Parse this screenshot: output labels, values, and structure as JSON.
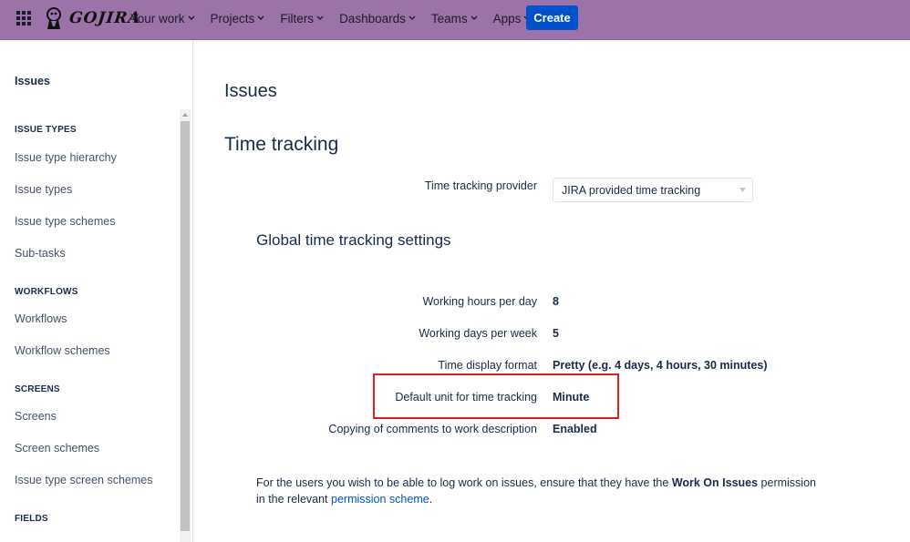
{
  "header": {
    "logo_text": "GOJIRA",
    "nav": [
      {
        "label": "Your work"
      },
      {
        "label": "Projects"
      },
      {
        "label": "Filters"
      },
      {
        "label": "Dashboards"
      },
      {
        "label": "Teams"
      },
      {
        "label": "Apps"
      }
    ],
    "create_label": "Create",
    "colors": {
      "bar": "#9b73a8",
      "create": "#0052cc"
    }
  },
  "sidebar": {
    "title": "Issues",
    "sections": [
      {
        "heading": "ISSUE TYPES",
        "items": [
          "Issue type hierarchy",
          "Issue types",
          "Issue type schemes",
          "Sub-tasks"
        ]
      },
      {
        "heading": "WORKFLOWS",
        "items": [
          "Workflows",
          "Workflow schemes"
        ]
      },
      {
        "heading": "SCREENS",
        "items": [
          "Screens",
          "Screen schemes",
          "Issue type screen schemes"
        ]
      },
      {
        "heading": "FIELDS",
        "items": []
      }
    ]
  },
  "main": {
    "page_title": "Issues",
    "section_title": "Time tracking",
    "provider": {
      "label": "Time tracking provider",
      "value": "JIRA provided time tracking"
    },
    "global_title": "Global time tracking settings",
    "settings": [
      {
        "label": "Working hours per day",
        "value": "8"
      },
      {
        "label": "Working days per week",
        "value": "5"
      },
      {
        "label": "Time display format",
        "value": "Pretty (e.g. 4 days, 4 hours, 30 minutes)"
      },
      {
        "label": "Default unit for time tracking",
        "value": "Minute"
      },
      {
        "label": "Copying of comments to work description",
        "value": "Enabled"
      }
    ],
    "note": {
      "text_before": "For the users you wish to be able to log work on issues, ensure that they have the ",
      "bold": "Work On Issues",
      "text_middle": " permission in the relevant ",
      "link": "permission scheme",
      "text_after": "."
    },
    "highlight_color": "#e21b1b"
  }
}
